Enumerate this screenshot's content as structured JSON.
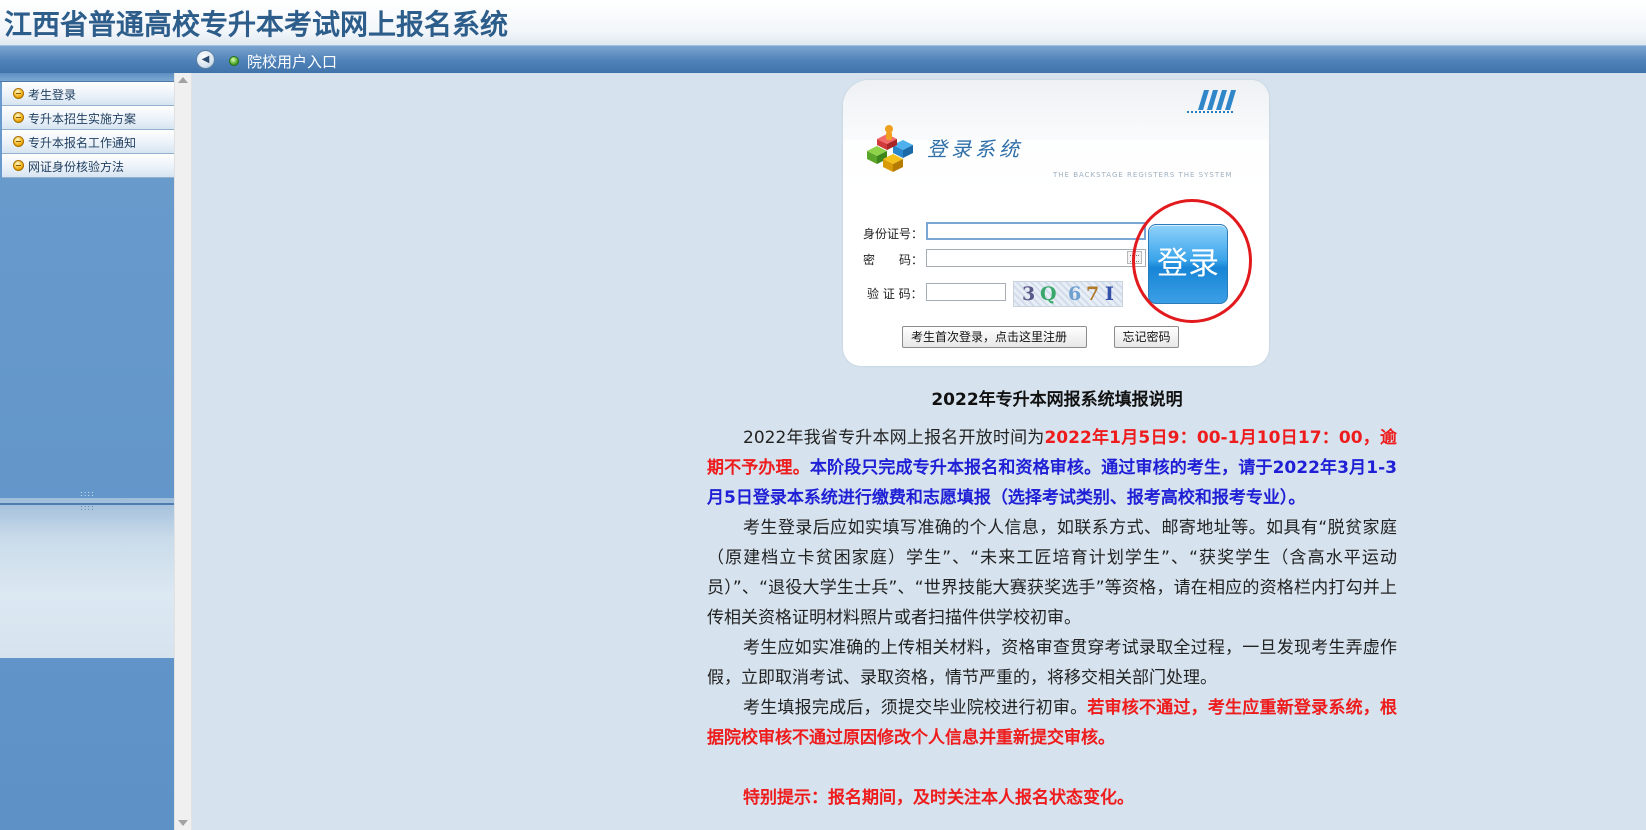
{
  "header": {
    "title": "江西省普通高校专升本考试网上报名系统"
  },
  "nav": {
    "collapse_icon": "◀",
    "link": "院校用户入口"
  },
  "sidebar": {
    "items": [
      {
        "label": "考生登录"
      },
      {
        "label": "专升本招生实施方案"
      },
      {
        "label": "专升本报名工作通知"
      },
      {
        "label": "网证身份核验方法"
      }
    ],
    "grip": "::::"
  },
  "login": {
    "title": "登录系统",
    "subtitle": "THE BACKSTAGE REGISTERS THE SYSTEM",
    "id_label": "身份证号：",
    "password_label": "密　　码：",
    "captcha_label": "验 证 码：",
    "id_value": "",
    "password_value": "",
    "captcha_value": "",
    "captcha_chars": [
      "3",
      "Q",
      "6",
      "7",
      "I"
    ],
    "login_button": "登录",
    "register_button": "考生首次登录，点击这里注册",
    "forgot_button": "忘记密码"
  },
  "notice": {
    "title": "2022年专升本网报系统填报说明",
    "p1": [
      "2022年我省专升本网上报名开放时间为",
      "2022年1月5日9：00-1月10日17：00，逾期不予办理。",
      "本阶段只完成专升本报名和资格审核。通过审核的考生，请于2022年3月1-3月5日登录本系统进行缴费和志愿填报（选择考试类别、报考高校和报考专业）。"
    ],
    "p2": "考生登录后应如实填写准确的个人信息，如联系方式、邮寄地址等。如具有“脱贫家庭（原建档立卡贫困家庭）学生”、“未来工匠培育计划学生”、“获奖学生（含高水平运动员）”、“退役大学生士兵”、“世界技能大赛获奖选手”等资格，请在相应的资格栏内打勾并上传相关资格证明材料照片或者扫描件供学校初审。",
    "p3": "考生应如实准确的上传相关材料，资格审查贯穿考试录取全过程，一旦发现考生弄虚作假，立即取消考试、录取资格，情节严重的，将移交相关部门处理。",
    "p4": [
      "考生填报完成后，须提交毕业院校进行初审。",
      "若审核不通过，考生应重新登录系统，根据院校审核不通过原因修改个人信息并重新提交审核。"
    ],
    "tip": "特别提示：报名期间，及时关注本人报名状态变化。"
  },
  "colors": {
    "header_title": "#2d5d8a",
    "nav_bg": "#4f82b8",
    "sidebar_bg": "#6a9bcd",
    "page_bg": "#d6e3ee",
    "highlight_red": "#ee1c1c",
    "highlight_blue": "#1f1fd6",
    "login_button": "#1785d6",
    "annotation_circle": "#e2191d"
  }
}
